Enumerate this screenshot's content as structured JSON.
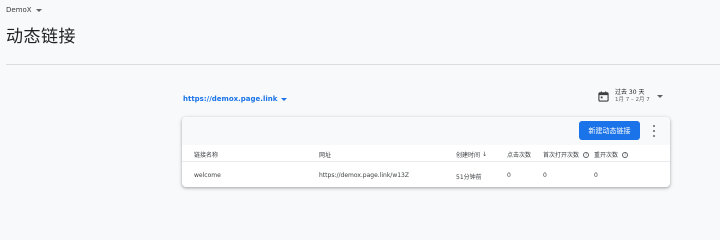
{
  "header": {
    "project_name": "DemoX",
    "title": "动态链接"
  },
  "domain": {
    "label": "https://demox.page.link"
  },
  "date_range": {
    "primary": "过去 30 天",
    "secondary": "1月 7 – 2月 7"
  },
  "toolbar": {
    "new_link_label": "新建动态链接"
  },
  "table": {
    "columns": {
      "name": "链接名称",
      "url": "网址",
      "created": "创建时间",
      "sort_indicator": "↓",
      "clicks": "点击次数",
      "first_opens": "首次打开次数",
      "reopens": "重开次数"
    },
    "rows": [
      {
        "name": "welcome",
        "url": "https://demox.page.link/w13Z",
        "created": "51分钟前",
        "clicks": "0",
        "first_opens": "0",
        "reopens": "0"
      }
    ]
  },
  "colors": {
    "accent": "#1a73e8",
    "background": "#f8f9fa",
    "card": "#ffffff"
  },
  "icons": {
    "calendar": "calendar-icon",
    "more": "more-vert-icon",
    "help": "help-outline-icon"
  }
}
